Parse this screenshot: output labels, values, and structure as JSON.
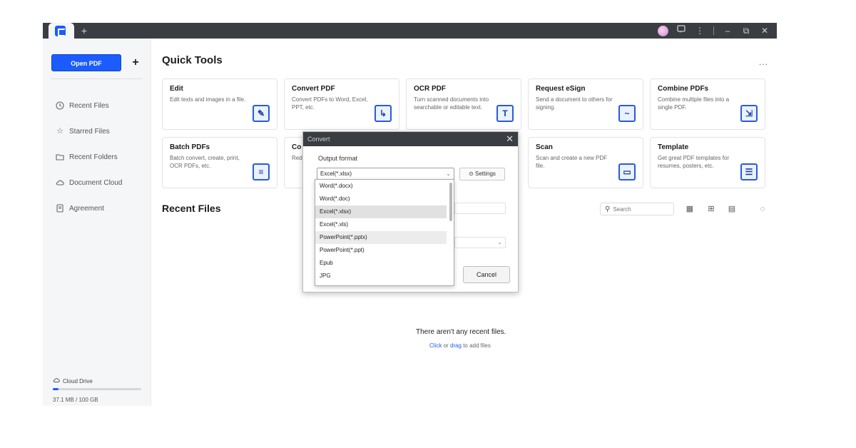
{
  "titlebar": {
    "add_tab": "+",
    "more": "⋮",
    "minimize": "–",
    "restore": "⧉",
    "close": "✕"
  },
  "sidebar": {
    "open_pdf": "Open PDF",
    "add": "+",
    "items": [
      {
        "label": "Recent Files",
        "icon": "clock-icon"
      },
      {
        "label": "Starred Files",
        "icon": "star-icon"
      },
      {
        "label": "Recent Folders",
        "icon": "folder-icon"
      },
      {
        "label": "Document Cloud",
        "icon": "cloud-icon"
      },
      {
        "label": "Agreement",
        "icon": "agreement-icon"
      }
    ],
    "cloud_drive": "Cloud Drive",
    "storage": "37.1 MB / 100 GB",
    "storage_used_fraction": 0.0004
  },
  "main": {
    "quick_tools_title": "Quick Tools",
    "more": "...",
    "tools": [
      {
        "title": "Edit",
        "desc": "Edit texts and images in a file.",
        "icon": "edit-icon"
      },
      {
        "title": "Convert PDF",
        "desc": "Convert PDFs to Word, Excel, PPT, etc.",
        "icon": "convert-icon"
      },
      {
        "title": "OCR PDF",
        "desc": "Turn scanned documents into searchable or editable text.",
        "icon": "ocr-icon"
      },
      {
        "title": "Request eSign",
        "desc": "Send a document to others for signing.",
        "icon": "esign-icon"
      },
      {
        "title": "Combine PDFs",
        "desc": "Combine multiple files into a single PDF.",
        "icon": "combine-icon"
      },
      {
        "title": "Batch PDFs",
        "desc": "Batch convert, create, print, OCR PDFs, etc.",
        "icon": "batch-icon"
      },
      {
        "title": "Co",
        "desc": "Red",
        "icon": ""
      },
      {
        "title": "Scan",
        "desc": "Scan and create a new PDF file.",
        "icon": "scan-icon"
      },
      {
        "title": "Template",
        "desc": "Get great PDF templates for resumes, posters, etc.",
        "icon": "template-icon"
      }
    ],
    "recent_files_title": "Recent Files",
    "search_placeholder": "Search",
    "empty_text": "There aren't any recent files.",
    "empty_hint": {
      "click": "Click",
      "or": "or",
      "drag": "drag",
      "rest": "to add files"
    }
  },
  "dialog": {
    "title": "Convert",
    "close": "✕",
    "output_format_label": "Output format",
    "selected": "Excel(*.xlsx)",
    "settings": "Settings",
    "cancel": "Cancel",
    "options": [
      "Word(*.docx)",
      "Word(*.doc)",
      "Excel(*.xlsx)",
      "Excel(*.xls)",
      "PowerPoint(*.pptx)",
      "PowerPoint(*.ppt)",
      "Epub",
      "JPG"
    ]
  },
  "colors": {
    "accent": "#1a5cff",
    "titlebar": "#3a3d42"
  }
}
